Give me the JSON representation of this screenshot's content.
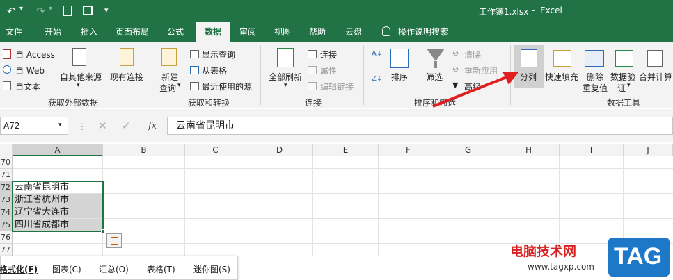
{
  "titlebar": {
    "filename": "工作簿1.xlsx",
    "separator": "-",
    "app": "Excel"
  },
  "tabs": [
    "文件",
    "开始",
    "插入",
    "页面布局",
    "公式",
    "数据",
    "审阅",
    "视图",
    "帮助",
    "云盘"
  ],
  "active_tab": "数据",
  "tell_me": "操作说明搜索",
  "ribbon": {
    "get_external": {
      "access": "自 Access",
      "web": "自 Web",
      "text": "自文本",
      "other": "自其他来源",
      "existing": "现有连接",
      "group": "获取外部数据"
    },
    "get_transform": {
      "new_query_1": "新建",
      "new_query_2": "查询",
      "show_queries": "显示查询",
      "from_table": "从表格",
      "recent": "最近使用的源",
      "group": "获取和转换"
    },
    "connections": {
      "refresh_all": "全部刷新",
      "conn": "连接",
      "props": "属性",
      "edit_links": "编辑链接",
      "group": "连接"
    },
    "sort_filter": {
      "sort": "排序",
      "filter": "筛选",
      "clear": "清除",
      "reapply": "重新应用",
      "advanced": "高级",
      "group": "排序和筛选"
    },
    "data_tools": {
      "split": "分列",
      "flash": "快速填充",
      "remove_dup_1": "删除",
      "remove_dup_2": "重复值",
      "validation_1": "数据验",
      "validation_2": "证",
      "consolidate": "合并计算",
      "group": "数据工具"
    }
  },
  "namebox": "A72",
  "formula": "云南省昆明市",
  "columns": [
    "A",
    "B",
    "C",
    "D",
    "E",
    "F",
    "G",
    "H",
    "I",
    "J"
  ],
  "rows": [
    "70",
    "71",
    "72",
    "73",
    "74",
    "75",
    "76",
    "77"
  ],
  "cells": {
    "A72": "云南省昆明市",
    "A73": "浙江省杭州市",
    "A74": "辽宁省大连市",
    "A75": "四川省成都市"
  },
  "quick_analysis": [
    "格式化(F)",
    "图表(C)",
    "汇总(O)",
    "表格(T)",
    "迷你图(S)"
  ],
  "watermark": {
    "site": "电脑技术网",
    "url": "www.tagxp.com",
    "badge": "TAG"
  },
  "colors": {
    "brand": "#217346",
    "arrow": "#e02020"
  }
}
